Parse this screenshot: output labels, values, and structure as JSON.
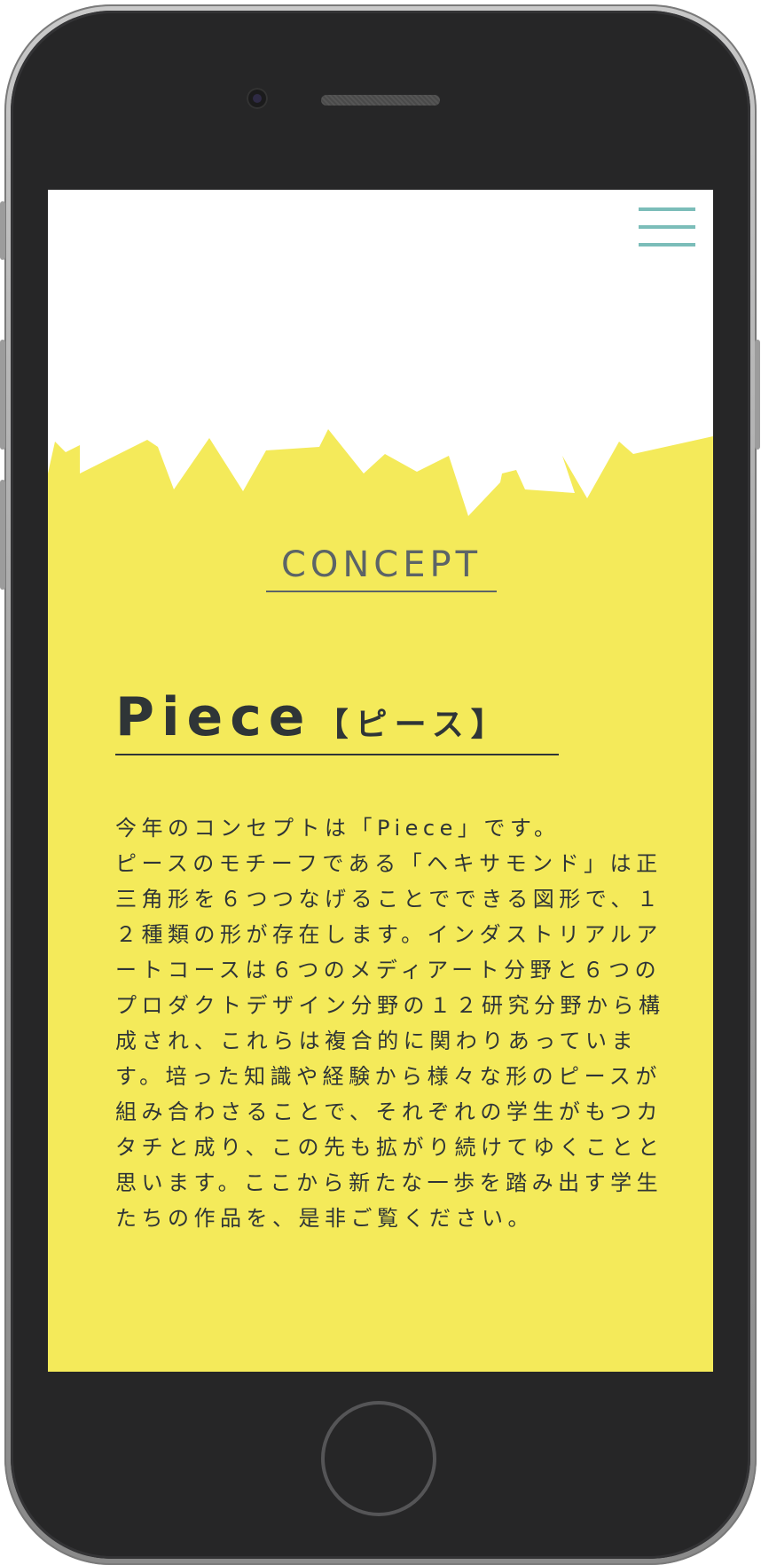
{
  "colors": {
    "accent_yellow": "#f4ea5a",
    "menu_teal": "#7bbdb9",
    "heading_gray": "#5c6467",
    "text_dark": "#2f3537",
    "device_body": "#262627"
  },
  "header": {
    "menu_icon": "hamburger-menu-icon"
  },
  "concept": {
    "heading": "CONCEPT",
    "title": "Piece",
    "title_kana": "【ピース】",
    "body_lines": [
      "今年のコンセプトは「Piece」です。",
      "ピースのモチーフである「ヘキサモンド」は正",
      "三角形を６つつなげることでできる図形で、１",
      "２種類の形が存在します。インダストリアルア",
      "ートコースは６つのメディアート分野と６つの",
      "プロダクトデザイン分野の１２研究分野から構",
      "成され、これらは複合的に関わりあっていま",
      "す。培った知識や経験から様々な形のピースが",
      "組み合わさることで、それぞれの学生がもつカ",
      "タチと成り、この先も拡がり続けてゆくことと",
      "思います。ここから新たな一歩を踏み出す学生",
      "たちの作品を、是非ご覧ください。"
    ]
  }
}
